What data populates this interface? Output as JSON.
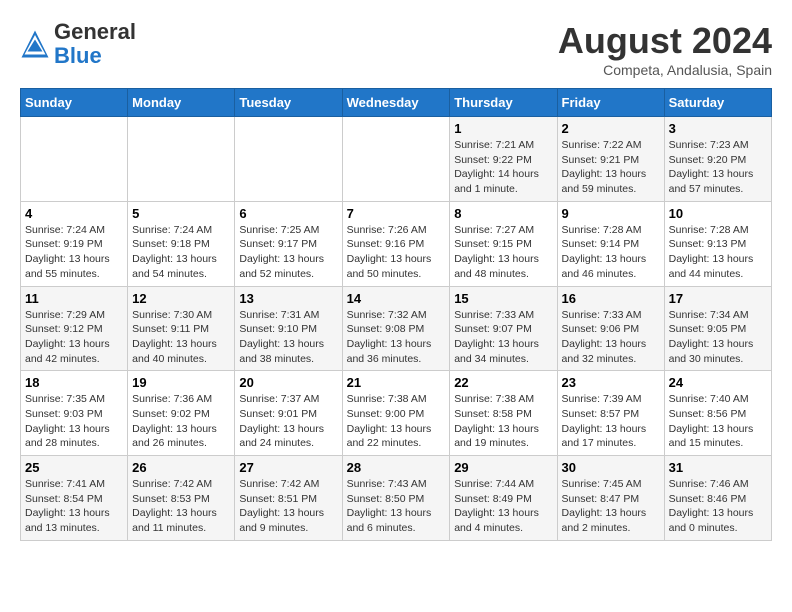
{
  "header": {
    "logo_general": "General",
    "logo_blue": "Blue",
    "month_year": "August 2024",
    "location": "Competa, Andalusia, Spain"
  },
  "weekdays": [
    "Sunday",
    "Monday",
    "Tuesday",
    "Wednesday",
    "Thursday",
    "Friday",
    "Saturday"
  ],
  "weeks": [
    [
      {
        "day": "",
        "info": ""
      },
      {
        "day": "",
        "info": ""
      },
      {
        "day": "",
        "info": ""
      },
      {
        "day": "",
        "info": ""
      },
      {
        "day": "1",
        "info": "Sunrise: 7:21 AM\nSunset: 9:22 PM\nDaylight: 14 hours\nand 1 minute."
      },
      {
        "day": "2",
        "info": "Sunrise: 7:22 AM\nSunset: 9:21 PM\nDaylight: 13 hours\nand 59 minutes."
      },
      {
        "day": "3",
        "info": "Sunrise: 7:23 AM\nSunset: 9:20 PM\nDaylight: 13 hours\nand 57 minutes."
      }
    ],
    [
      {
        "day": "4",
        "info": "Sunrise: 7:24 AM\nSunset: 9:19 PM\nDaylight: 13 hours\nand 55 minutes."
      },
      {
        "day": "5",
        "info": "Sunrise: 7:24 AM\nSunset: 9:18 PM\nDaylight: 13 hours\nand 54 minutes."
      },
      {
        "day": "6",
        "info": "Sunrise: 7:25 AM\nSunset: 9:17 PM\nDaylight: 13 hours\nand 52 minutes."
      },
      {
        "day": "7",
        "info": "Sunrise: 7:26 AM\nSunset: 9:16 PM\nDaylight: 13 hours\nand 50 minutes."
      },
      {
        "day": "8",
        "info": "Sunrise: 7:27 AM\nSunset: 9:15 PM\nDaylight: 13 hours\nand 48 minutes."
      },
      {
        "day": "9",
        "info": "Sunrise: 7:28 AM\nSunset: 9:14 PM\nDaylight: 13 hours\nand 46 minutes."
      },
      {
        "day": "10",
        "info": "Sunrise: 7:28 AM\nSunset: 9:13 PM\nDaylight: 13 hours\nand 44 minutes."
      }
    ],
    [
      {
        "day": "11",
        "info": "Sunrise: 7:29 AM\nSunset: 9:12 PM\nDaylight: 13 hours\nand 42 minutes."
      },
      {
        "day": "12",
        "info": "Sunrise: 7:30 AM\nSunset: 9:11 PM\nDaylight: 13 hours\nand 40 minutes."
      },
      {
        "day": "13",
        "info": "Sunrise: 7:31 AM\nSunset: 9:10 PM\nDaylight: 13 hours\nand 38 minutes."
      },
      {
        "day": "14",
        "info": "Sunrise: 7:32 AM\nSunset: 9:08 PM\nDaylight: 13 hours\nand 36 minutes."
      },
      {
        "day": "15",
        "info": "Sunrise: 7:33 AM\nSunset: 9:07 PM\nDaylight: 13 hours\nand 34 minutes."
      },
      {
        "day": "16",
        "info": "Sunrise: 7:33 AM\nSunset: 9:06 PM\nDaylight: 13 hours\nand 32 minutes."
      },
      {
        "day": "17",
        "info": "Sunrise: 7:34 AM\nSunset: 9:05 PM\nDaylight: 13 hours\nand 30 minutes."
      }
    ],
    [
      {
        "day": "18",
        "info": "Sunrise: 7:35 AM\nSunset: 9:03 PM\nDaylight: 13 hours\nand 28 minutes."
      },
      {
        "day": "19",
        "info": "Sunrise: 7:36 AM\nSunset: 9:02 PM\nDaylight: 13 hours\nand 26 minutes."
      },
      {
        "day": "20",
        "info": "Sunrise: 7:37 AM\nSunset: 9:01 PM\nDaylight: 13 hours\nand 24 minutes."
      },
      {
        "day": "21",
        "info": "Sunrise: 7:38 AM\nSunset: 9:00 PM\nDaylight: 13 hours\nand 22 minutes."
      },
      {
        "day": "22",
        "info": "Sunrise: 7:38 AM\nSunset: 8:58 PM\nDaylight: 13 hours\nand 19 minutes."
      },
      {
        "day": "23",
        "info": "Sunrise: 7:39 AM\nSunset: 8:57 PM\nDaylight: 13 hours\nand 17 minutes."
      },
      {
        "day": "24",
        "info": "Sunrise: 7:40 AM\nSunset: 8:56 PM\nDaylight: 13 hours\nand 15 minutes."
      }
    ],
    [
      {
        "day": "25",
        "info": "Sunrise: 7:41 AM\nSunset: 8:54 PM\nDaylight: 13 hours\nand 13 minutes."
      },
      {
        "day": "26",
        "info": "Sunrise: 7:42 AM\nSunset: 8:53 PM\nDaylight: 13 hours\nand 11 minutes."
      },
      {
        "day": "27",
        "info": "Sunrise: 7:42 AM\nSunset: 8:51 PM\nDaylight: 13 hours\nand 9 minutes."
      },
      {
        "day": "28",
        "info": "Sunrise: 7:43 AM\nSunset: 8:50 PM\nDaylight: 13 hours\nand 6 minutes."
      },
      {
        "day": "29",
        "info": "Sunrise: 7:44 AM\nSunset: 8:49 PM\nDaylight: 13 hours\nand 4 minutes."
      },
      {
        "day": "30",
        "info": "Sunrise: 7:45 AM\nSunset: 8:47 PM\nDaylight: 13 hours\nand 2 minutes."
      },
      {
        "day": "31",
        "info": "Sunrise: 7:46 AM\nSunset: 8:46 PM\nDaylight: 13 hours\nand 0 minutes."
      }
    ]
  ]
}
